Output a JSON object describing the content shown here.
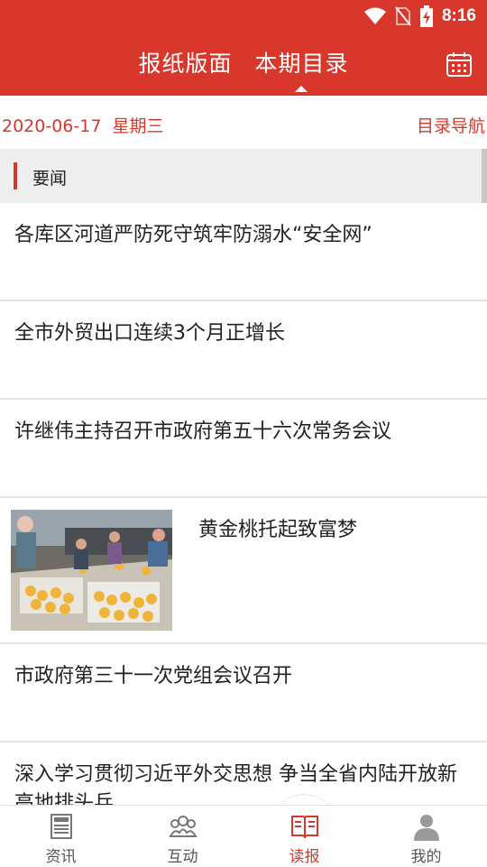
{
  "status_bar": {
    "time": "8:16"
  },
  "header": {
    "tabs": [
      {
        "label": "报纸版面",
        "active": false
      },
      {
        "label": "本期目录",
        "active": true
      }
    ],
    "calendar_icon": "calendar-icon"
  },
  "date_bar": {
    "date": "2020-06-17  星期三",
    "toc_nav_label": "目录导航"
  },
  "section": {
    "title": "要闻"
  },
  "articles": [
    {
      "title": "各库区河道严防死守筑牢防溺水“安全网”"
    },
    {
      "title": "全市外贸出口连续3个月正增长"
    },
    {
      "title": "许继伟主持召开市政府第五十六次常务会议"
    },
    {
      "title": "黄金桃托起致富梦",
      "has_image": true
    },
    {
      "title": "市政府第三十一次党组会议召开"
    },
    {
      "title": "深入学习贯彻习近平外交思想 争当全省内陆开放新高地排头兵"
    }
  ],
  "bottom_nav": [
    {
      "label": "资讯",
      "icon": "newspaper-icon",
      "active": false
    },
    {
      "label": "互动",
      "icon": "group-icon",
      "active": false
    },
    {
      "label": "读报",
      "icon": "book-icon",
      "active": true
    },
    {
      "label": "我的",
      "icon": "user-icon",
      "active": false
    }
  ],
  "colors": {
    "brand": "#d9372b",
    "divider": "#e4e4e4",
    "section_bg": "#eeeeee"
  }
}
